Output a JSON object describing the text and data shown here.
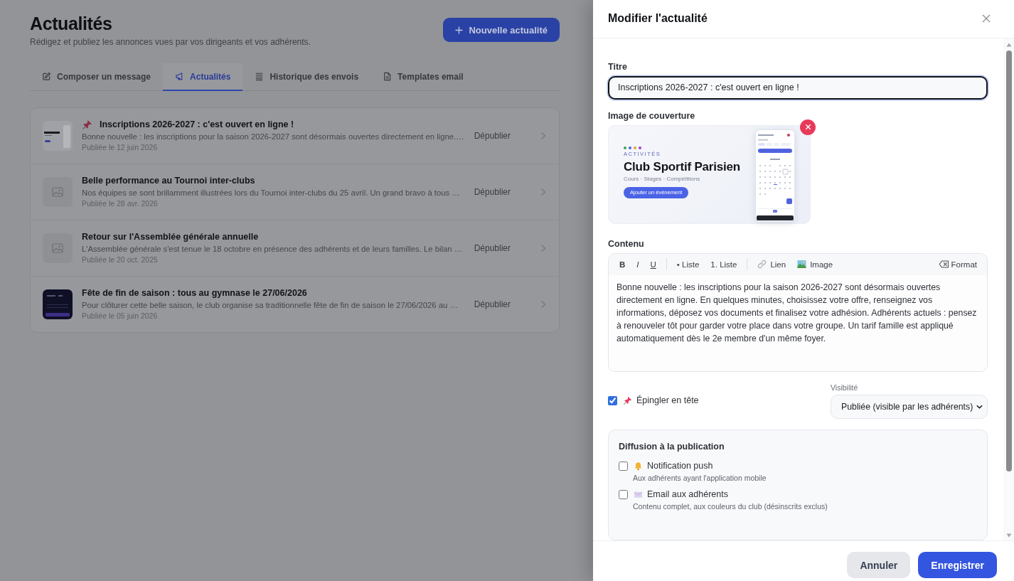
{
  "page": {
    "title": "Actualités",
    "subtitle": "Rédigez et publiez les annonces vues par vos dirigeants et vos adhérents.",
    "new_button": "Nouvelle actualité"
  },
  "tabs": [
    {
      "label": "Composer un message",
      "selected": false
    },
    {
      "label": "Actualités",
      "selected": true
    },
    {
      "label": "Historique des envois",
      "selected": false
    },
    {
      "label": "Templates email",
      "selected": false
    }
  ],
  "news": [
    {
      "kind": "cover",
      "pinned": true,
      "title": "Inscriptions 2026-2027 : c'est ouvert en ligne !",
      "excerpt": "Bonne nouvelle : les inscriptions pour la saison 2026-2027 sont désormais ouvertes directement en ligne.…",
      "date": "Publiée le 12 juin 2026",
      "action": "Dépublier"
    },
    {
      "kind": "placeholder",
      "pinned": false,
      "title": "Belle performance au Tournoi inter-clubs",
      "excerpt": "Nos équipes se sont brillamment illustrées lors du Tournoi inter-clubs du 25 avril. Un grand bravo à tous …",
      "date": "Publiée le 28 avr. 2026",
      "action": "Dépublier"
    },
    {
      "kind": "placeholder",
      "pinned": false,
      "title": "Retour sur l'Assemblée générale annuelle",
      "excerpt": "L'Assemblée générale s'est tenue le 18 octobre en présence des adhérents et de leurs familles. Le bilan …",
      "date": "Publiée le 20 oct. 2025",
      "action": "Dépublier"
    },
    {
      "kind": "poster",
      "pinned": false,
      "title": "Fête de fin de saison : tous au gymnase le 27/06/2026",
      "excerpt": "Pour clôturer cette belle saison, le club organise sa traditionnelle fête de fin de saison le 27/06/2026 au …",
      "date": "Publiée le 05 juin 2026",
      "action": "Dépublier"
    }
  ],
  "drawer": {
    "title": "Modifier l'actualité",
    "title_label": "Titre",
    "title_value": "Inscriptions 2026-2027 : c'est ouvert en ligne !",
    "cover_label": "Image de couverture",
    "cover_image": {
      "dots": [
        {
          "color": "#3fa45b"
        },
        {
          "color": "#4f63e0"
        },
        {
          "color": "#e9a23b"
        },
        {
          "color": "#9b45c2"
        }
      ],
      "tagline": "ACTIVITÉS",
      "heading": "Club Sportif Parisien",
      "subheading": "Cours · Stages · Compétitions",
      "cta": "Ajouter un événement"
    },
    "content_label": "Contenu",
    "toolbar_groups": [
      [
        {
          "label": "B",
          "kind": "bold"
        },
        {
          "label": "I",
          "kind": "italic"
        },
        {
          "label": "U",
          "kind": "underline"
        }
      ],
      [
        {
          "label": "• Liste",
          "kind": "text"
        },
        {
          "label": "1. Liste",
          "kind": "text"
        }
      ],
      [
        {
          "label": "Lien",
          "kind": "link"
        },
        {
          "label": "Image",
          "kind": "image"
        }
      ]
    ],
    "format_button": "Format",
    "content": "Bonne nouvelle : les inscriptions pour la saison 2026-2027 sont désormais ouvertes directement en ligne. En quelques minutes, choisissez votre offre, renseignez vos informations, déposez vos documents et finalisez votre adhésion. Adhérents actuels : pensez à renouveler tôt pour garder votre place dans votre groupe. Un tarif famille est appliqué automatiquement dès le 2e membre d'un même foyer.",
    "pin": {
      "label": "Épingler en tête",
      "checked": true
    },
    "visibility": {
      "label": "Visibilité",
      "value": "Publiée (visible par les adhérents)"
    },
    "diffusion": {
      "title": "Diffusion à la publication",
      "options": [
        {
          "kind": "push",
          "label": "Notification push",
          "hint": "Aux adhérents ayant l'application mobile",
          "checked": false
        },
        {
          "kind": "email",
          "label": "Email aux adhérents",
          "hint": "Contenu complet, aux couleurs du club (désinscrits exclus)",
          "checked": false
        }
      ]
    }
  },
  "footer": {
    "buttons": [
      {
        "label": "Annuler",
        "kind": "secondary"
      },
      {
        "label": "Enregistrer",
        "kind": "primary"
      }
    ]
  }
}
